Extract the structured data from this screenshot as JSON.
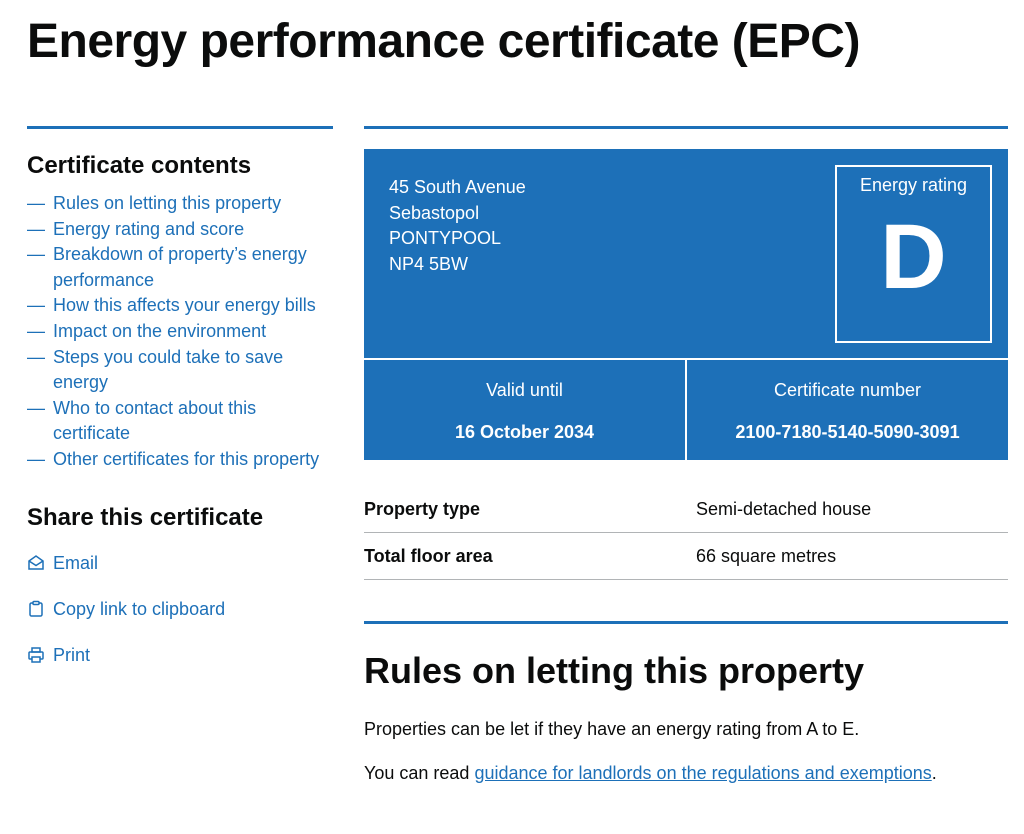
{
  "page": {
    "title": "Energy performance certificate (EPC)"
  },
  "sidebar": {
    "contents_title": "Certificate contents",
    "contents": [
      "Rules on letting this property",
      "Energy rating and score",
      "Breakdown of property’s energy performance",
      "How this affects your energy bills",
      "Impact on the environment",
      "Steps you could take to save energy",
      "Who to contact about this certificate",
      "Other certificates for this property"
    ],
    "dash": "—",
    "share_title": "Share this certificate",
    "share": {
      "email": "Email",
      "copy": "Copy link to clipboard",
      "print": "Print"
    }
  },
  "epc": {
    "address": [
      "45 South Avenue",
      "Sebastopol",
      "PONTYPOOL",
      "NP4 5BW"
    ],
    "rating_label": "Energy rating",
    "rating": "D",
    "valid_label": "Valid until",
    "valid_value": "16 October 2034",
    "cert_label": "Certificate number",
    "cert_value": "2100-7180-5140-5090-3091"
  },
  "summary": [
    {
      "key": "Property type",
      "value": "Semi-detached house"
    },
    {
      "key": "Total floor area",
      "value": "66 square metres"
    }
  ],
  "section": {
    "title": "Rules on letting this property",
    "para1": "Properties can be let if they have an energy rating from A to E.",
    "para2_prefix": "You can read ",
    "para2_link": "guidance for landlords on the regulations and exemptions",
    "para2_suffix": "."
  },
  "colors": {
    "accent": "#1d70b8",
    "text": "#0b0c0c",
    "border": "#b1b4b6"
  }
}
